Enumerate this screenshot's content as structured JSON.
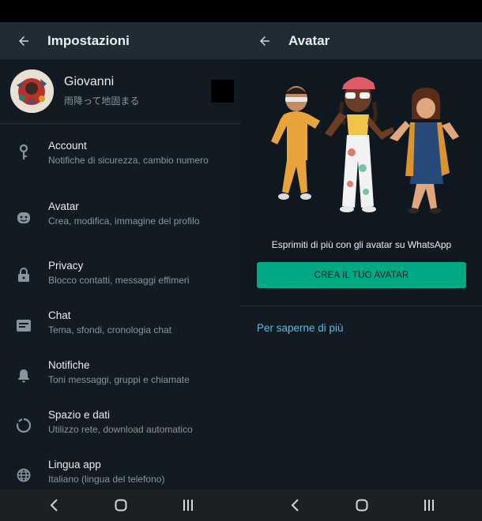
{
  "settings": {
    "title": "Impostazioni",
    "profile": {
      "name": "Giovanni",
      "status": "雨降って地固まる"
    },
    "items": [
      {
        "label": "Account",
        "sub": "Notifiche di sicurezza, cambio numero",
        "icon": "key-icon"
      },
      {
        "label": "Avatar",
        "sub": "Crea, modifica, immagine del profilo",
        "icon": "avatar-icon"
      },
      {
        "label": "Privacy",
        "sub": "Blocco contatti, messaggi effimeri",
        "icon": "lock-icon"
      },
      {
        "label": "Chat",
        "sub": "Tema, sfondi, cronologia chat",
        "icon": "chat-icon"
      },
      {
        "label": "Notifiche",
        "sub": "Toni messaggi, gruppi e chiamate",
        "icon": "bell-icon"
      },
      {
        "label": "Spazio e dati",
        "sub": "Utilizzo rete, download automatico",
        "icon": "data-usage-icon"
      },
      {
        "label": "Lingua app",
        "sub": "Italiano (lingua del telefono)",
        "icon": "globe-icon"
      }
    ]
  },
  "avatar_screen": {
    "title": "Avatar",
    "tagline": "Esprimiti di più con gli avatar su WhatsApp",
    "cta_label": "CREA IL TUO AVATAR",
    "learn_more": "Per saperne di più"
  },
  "colors": {
    "accent": "#00a884",
    "link": "#53bdeb",
    "background": "#121b22",
    "appbar": "#1f2c34"
  }
}
